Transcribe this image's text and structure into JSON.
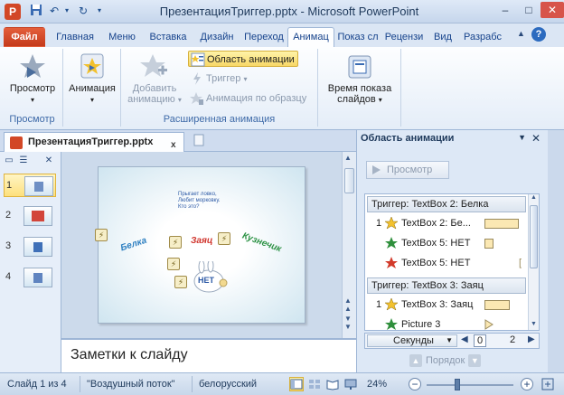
{
  "window": {
    "title": "ПрезентацияТриггер.pptx - Microsoft PowerPoint",
    "app_icon": "P",
    "minimize": "–",
    "maximize": "□",
    "close": "✕"
  },
  "qat": [
    "save-icon",
    "undo-icon",
    "redo-icon",
    "customize-icon"
  ],
  "ribbon_tabs": [
    {
      "label": "Файл",
      "kind": "file"
    },
    {
      "label": "Главная"
    },
    {
      "label": "Меню"
    },
    {
      "label": "Вставка"
    },
    {
      "label": "Дизайн"
    },
    {
      "label": "Переход"
    },
    {
      "label": "Анимац",
      "active": true
    },
    {
      "label": "Показ сл"
    },
    {
      "label": "Рецензи"
    },
    {
      "label": "Вид"
    },
    {
      "label": "Разрабс"
    }
  ],
  "help_label": "?",
  "ribbon": {
    "preview_group": {
      "button": "Просмотр",
      "label": "Просмотр"
    },
    "animation_button": "Анимация",
    "add_animation": [
      "Добавить",
      "анимацию"
    ],
    "animation_pane_button": "Область анимации",
    "trigger_button": "Триггер",
    "painter_button": "Анимация по образцу",
    "advanced_label": "Расширенная анимация",
    "timing_button": [
      "Время показа",
      "слайдов"
    ]
  },
  "doc_tab": {
    "title": "ПрезентацияТриггер.pptx",
    "close": "x"
  },
  "slides": [
    {
      "number": "1",
      "selected": true
    },
    {
      "number": "2"
    },
    {
      "number": "3"
    },
    {
      "number": "4"
    }
  ],
  "slide_content": {
    "riddle": [
      "Прыгает ловко,",
      "Любит морковку.",
      "Кто это?"
    ],
    "belka": "Белка",
    "zayac": "Заяц",
    "kuznechik": "Кузнечик",
    "net": "НЕТ"
  },
  "notes_placeholder": "Заметки к слайду",
  "anim_pane": {
    "title": "Область анимации",
    "preview": "Просмотр",
    "triggers": [
      {
        "header": "Триггер: TextBox 2: Белка",
        "items": [
          {
            "num": "1",
            "label": "TextBox 2: Бе...",
            "star": "#f2c12e"
          },
          {
            "num": "",
            "label": "TextBox 5: НЕТ",
            "star": "#2f8f3c"
          },
          {
            "num": "",
            "label": "TextBox 5: НЕТ",
            "star": "#d23a2a"
          }
        ]
      },
      {
        "header": "Триггер: TextBox 3: Заяц",
        "items": [
          {
            "num": "1",
            "label": "TextBox 3: Заяц",
            "star": "#f2c12e"
          },
          {
            "num": "",
            "label": "Picture 3",
            "star": "#2f8f3c"
          }
        ]
      }
    ],
    "seconds": "Секунды",
    "timeline_values": [
      "0",
      "2"
    ],
    "order": "Порядок"
  },
  "status": {
    "slide": "Слайд 1 из 4",
    "theme": "\"Воздушный поток\"",
    "language": "белорусский",
    "zoom": "24%"
  }
}
